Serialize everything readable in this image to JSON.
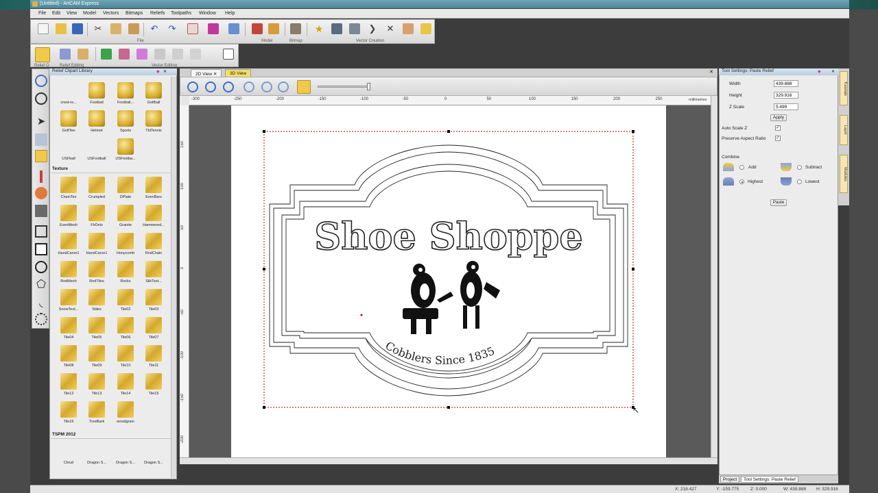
{
  "window": {
    "title": "(Untitled) - ArtCAM Express"
  },
  "menu": [
    "File",
    "Edit",
    "View",
    "Model",
    "Vectors",
    "Bitmaps",
    "Reliefs",
    "Toolpaths",
    "Window",
    "Help"
  ],
  "toolbar": {
    "group_labels": {
      "file": "File",
      "model": "Model",
      "bitmap": "Bitmap",
      "vector_creation": "Vector Creation",
      "relief_o": "Relief O",
      "relief_editing": "Relief Editing",
      "vector_editing": "Vector Editing"
    }
  },
  "clipart_panel": {
    "title": "Relief Clipart Library",
    "sports_items": [
      "crest-re...",
      "Football",
      "Football...",
      "Golfball",
      "GolfTee",
      "Helmet",
      "Sports",
      "TblTennis",
      "USFball",
      "USFootball",
      "USFootba..."
    ],
    "texture_header": "Texture",
    "texture_items": [
      "ChainTex",
      "Crumpled",
      "DPlate",
      "EvenBars",
      "EvenMesh",
      "FlrDels",
      "Granite",
      "Hammered...",
      "HandCarve1",
      "HandCarve1",
      "Honycomb",
      "RndChain",
      "RndMesh",
      "RndTiles",
      "Rocks",
      "SilkText...",
      "SnowText...",
      "Stiles",
      "Tile02",
      "Tile03",
      "Tile04",
      "Tile05",
      "Tile06",
      "Tile07",
      "Tile08",
      "Tile09",
      "Tile10",
      "Tile11",
      "Tile12",
      "Tile13",
      "Tile14",
      "Tile15",
      "Tile16",
      "TreeBark",
      "woodgrain"
    ],
    "tspm_header": "TSPM 2012",
    "tspm_items": [
      "Cloud",
      "Dragon S...",
      "Dragon S...",
      "Dragon S..."
    ]
  },
  "view": {
    "tabs": [
      "2D View",
      "3D View"
    ],
    "ruler_top": [
      "-300",
      "-250",
      "-200",
      "-150",
      "-100",
      "-50",
      "0",
      "50",
      "100",
      "150",
      "200",
      "250"
    ],
    "ruler_left": [
      "150",
      "100",
      "50",
      "0",
      "-50",
      "-100",
      "-150",
      "-200"
    ],
    "units": "millimetres",
    "sign": {
      "title": "Shoe Shoppe",
      "subtitle": "Cobblers Since 1835"
    }
  },
  "tool_settings": {
    "title": "Tool Settings: Paste Relief",
    "width_label": "Width",
    "width": "439.888",
    "height_label": "Height",
    "height": "329.916",
    "zscale_label": "Z Scale",
    "zscale": "5.499",
    "apply": "Apply",
    "auto_scale_z": "Auto Scale Z",
    "preserve_aspect": "Preserve Aspect Ratio",
    "combine_label": "Combine",
    "add": "Add",
    "subtract": "Subtract",
    "highest": "Highest",
    "lowest": "Lowest",
    "paste": "Paste"
  },
  "side_tabs": [
    "Tutorials",
    "Layer",
    "Modules"
  ],
  "bottom_tabs": [
    "Project",
    "Tool Settings: Paste Relief"
  ],
  "status": {
    "x": "X: 218.427",
    "y": "Y: -159.775",
    "z": "Z: 0.000",
    "w": "W: 439.888",
    "h": "H: 329.916"
  },
  "colors": {
    "accent_gold": "#d7ad2d",
    "selection": "#c00000",
    "title_blue": "#4b8597"
  }
}
